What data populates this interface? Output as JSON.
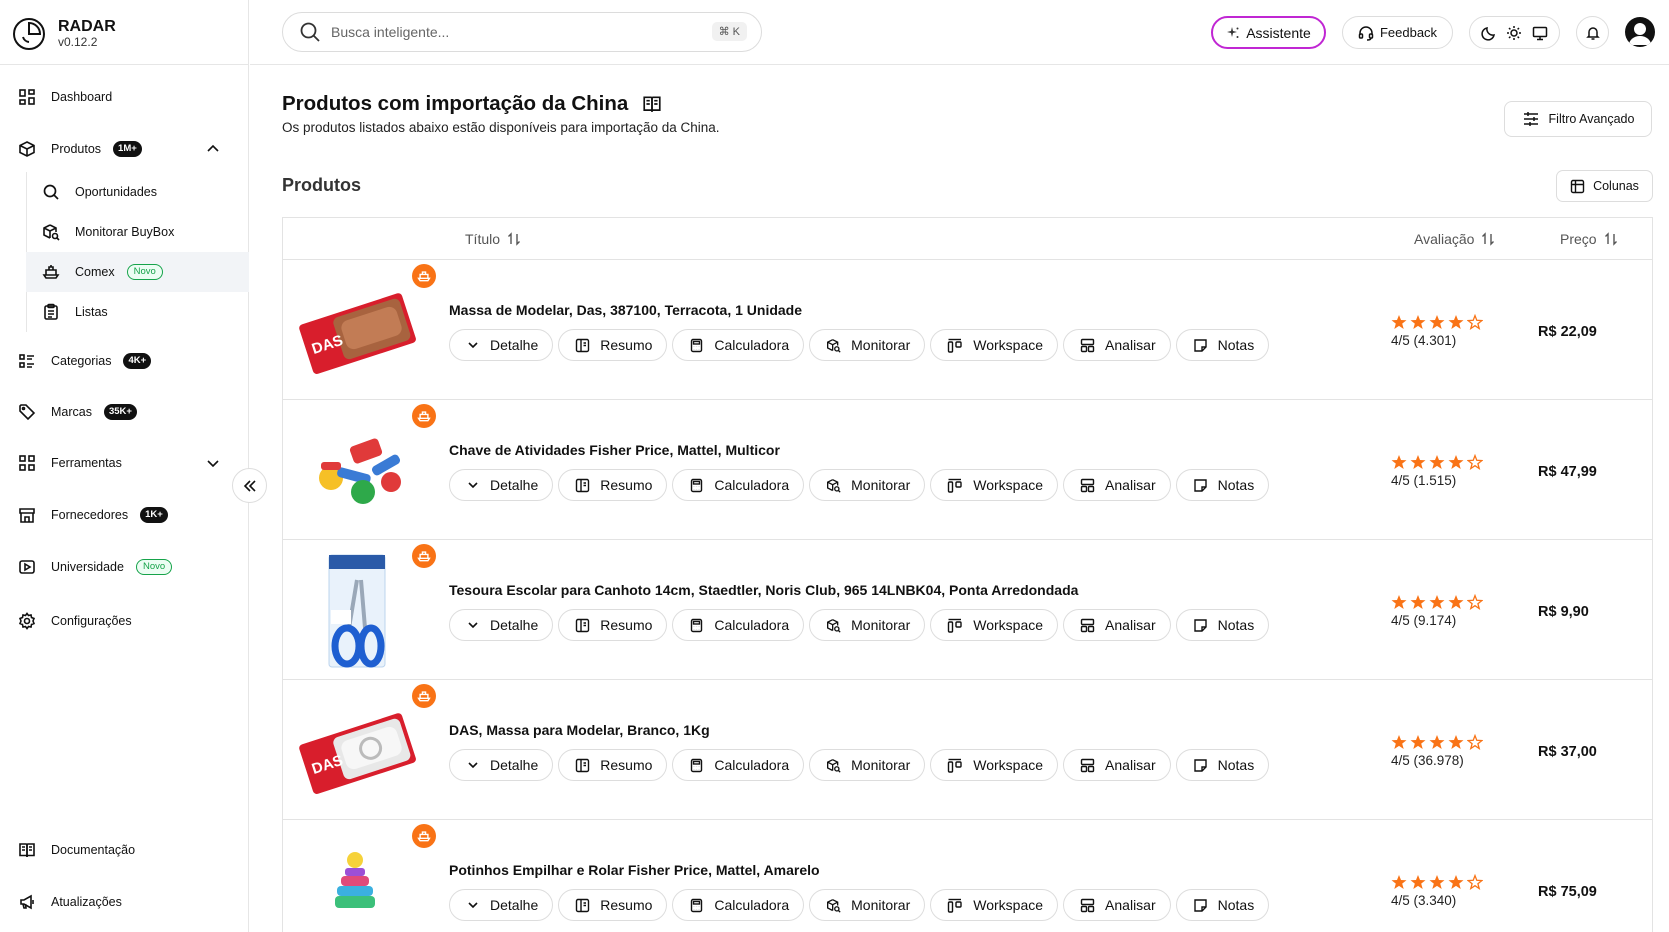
{
  "app": {
    "name": "RADAR",
    "version": "v0.12.2"
  },
  "sidebar": {
    "items": [
      {
        "label": "Dashboard",
        "icon": "dashboard-icon"
      },
      {
        "label": "Produtos",
        "badge": "1M+",
        "icon": "package-icon"
      },
      {
        "label": "Categorias",
        "badge": "4K+",
        "icon": "list-icon"
      },
      {
        "label": "Marcas",
        "badge": "35K+",
        "icon": "tag-icon"
      },
      {
        "label": "Ferramentas",
        "icon": "tools-grid-icon"
      },
      {
        "label": "Fornecedores",
        "badge": "1K+",
        "icon": "store-icon"
      },
      {
        "label": "Universidade",
        "badge": "Novo",
        "icon": "play-video-icon"
      },
      {
        "label": "Configurações",
        "icon": "gear-icon"
      }
    ],
    "sub_items": [
      {
        "label": "Oportunidades",
        "icon": "search-icon"
      },
      {
        "label": "Monitorar BuyBox",
        "icon": "box-search-icon"
      },
      {
        "label": "Comex",
        "badge": "Novo",
        "icon": "ship-icon",
        "active": true
      },
      {
        "label": "Listas",
        "icon": "clipboard-list-icon"
      }
    ],
    "footer": [
      {
        "label": "Documentação",
        "icon": "book-icon"
      },
      {
        "label": "Atualizações",
        "icon": "megaphone-icon"
      }
    ]
  },
  "topbar": {
    "search_placeholder": "Busca inteligente...",
    "search_shortcut": "⌘ K",
    "assistant_label": "Assistente",
    "feedback_label": "Feedback"
  },
  "page": {
    "title": "Produtos com importação da China",
    "subtitle": "Os produtos listados abaixo estão disponíveis para importação da China.",
    "filter_label": "Filtro Avançado",
    "section_title": "Produtos",
    "columns_label": "Colunas"
  },
  "table": {
    "headers": {
      "title": "Título",
      "rating": "Avaliação",
      "price": "Preço"
    },
    "actions": [
      "Detalhe",
      "Resumo",
      "Calculadora",
      "Monitorar",
      "Workspace",
      "Analisar",
      "Notas"
    ],
    "rows": [
      {
        "title": "Massa de Modelar, Das, 387100, Terracota, 1 Unidade",
        "stars": 4,
        "rating": "4/5 (4.301)",
        "price": "R$ 22,09",
        "img": "terracota"
      },
      {
        "title": "Chave de Atividades Fisher Price, Mattel, Multicor",
        "stars": 4,
        "rating": "4/5 (1.515)",
        "price": "R$ 47,99",
        "img": "keys"
      },
      {
        "title": "Tesoura Escolar para Canhoto 14cm, Staedtler, Noris Club, 965 14LNBK04, Ponta Arredondada",
        "stars": 4,
        "rating": "4/5 (9.174)",
        "price": "R$ 9,90",
        "img": "scissors"
      },
      {
        "title": "DAS, Massa para Modelar, Branco, 1Kg",
        "stars": 4,
        "rating": "4/5 (36.978)",
        "price": "R$ 37,00",
        "img": "white"
      },
      {
        "title": "Potinhos Empilhar e Rolar Fisher Price, Mattel, Amarelo",
        "stars": 4,
        "rating": "4/5 (3.340)",
        "price": "R$ 75,09",
        "img": "stack"
      }
    ]
  },
  "colors": {
    "accent": "#c026d3",
    "star": "#f97316",
    "badge": "#f97316",
    "green": "#16a34a"
  }
}
